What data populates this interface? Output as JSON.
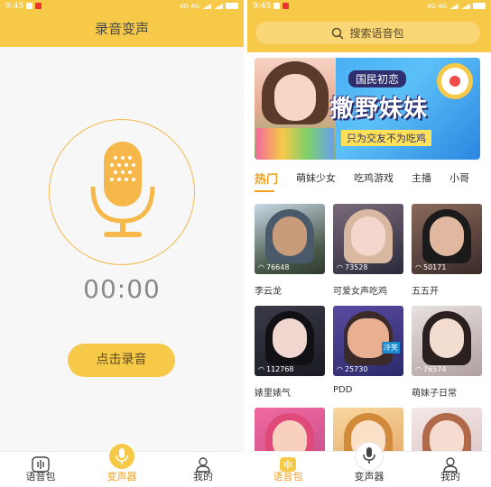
{
  "status": {
    "time": "9:45",
    "indicators": "4G 4G"
  },
  "left": {
    "title": "录音变声",
    "timer": "00:00",
    "record_button": "点击录音",
    "icons": {
      "mic": "microphone-icon"
    },
    "colors": {
      "accent": "#f7c948",
      "ring": "#f6b84a"
    }
  },
  "right": {
    "search_placeholder": "搜索语音包",
    "banner": {
      "tag_top": "国民初恋",
      "headline": "撒野妹妹",
      "tagline": "只为交友不为吃鸡"
    },
    "tabs": [
      "热门",
      "萌妹少女",
      "吃鸡游戏",
      "主播",
      "小哥"
    ],
    "cards": [
      {
        "label": "李云龙",
        "count": "76648"
      },
      {
        "label": "可爱女声吃鸡",
        "count": "73528"
      },
      {
        "label": "五五开",
        "count": "50171"
      },
      {
        "label": "婊里婊气",
        "count": "112768"
      },
      {
        "label": "PDD",
        "count": "25730"
      },
      {
        "label": "萌妹子日常",
        "count": "76574"
      },
      {
        "label": "",
        "count": ""
      },
      {
        "label": "",
        "count": ""
      },
      {
        "label": "",
        "count": ""
      }
    ]
  },
  "nav": {
    "left": [
      {
        "label": "语音包"
      },
      {
        "label": "变声器"
      },
      {
        "label": "我的"
      }
    ],
    "right": [
      {
        "label": "语音包"
      },
      {
        "label": "变声器"
      },
      {
        "label": "我的"
      }
    ]
  }
}
